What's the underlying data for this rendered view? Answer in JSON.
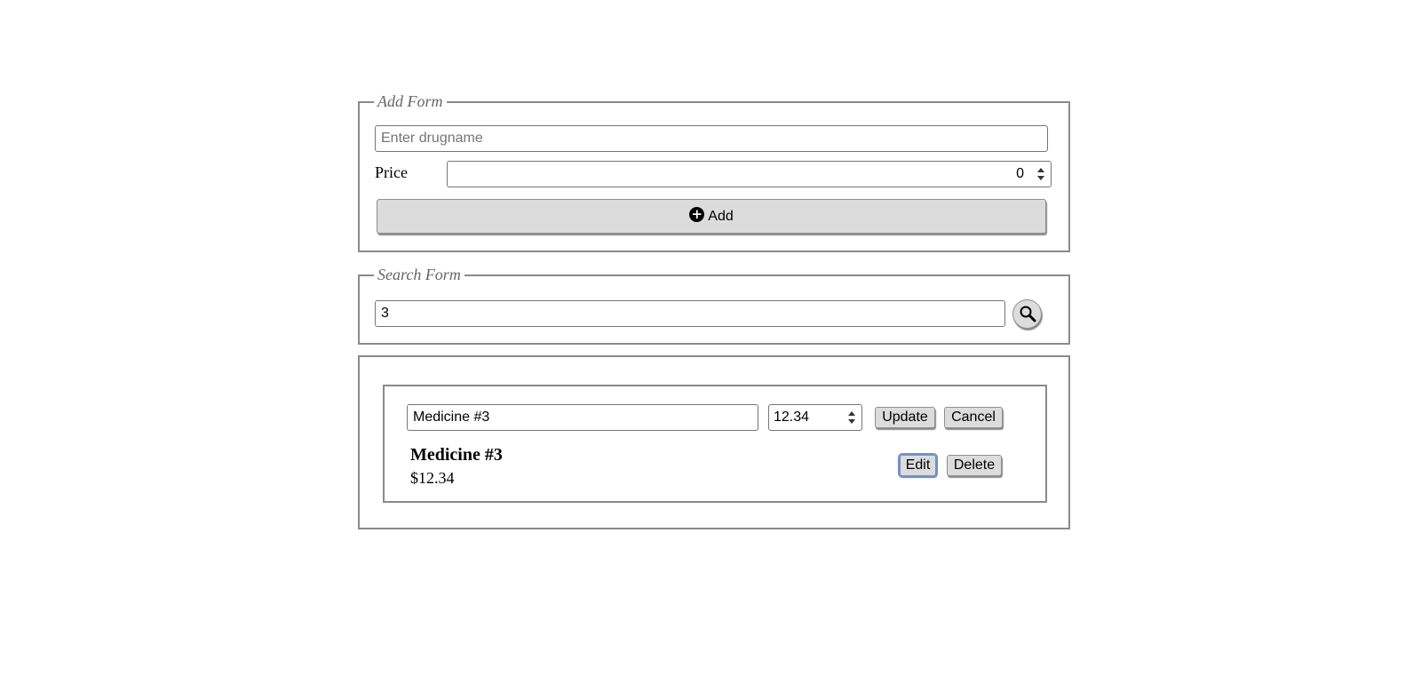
{
  "add_form": {
    "legend": "Add Form",
    "drugname_placeholder": "Enter drugname",
    "drugname_value": "",
    "price_label": "Price",
    "price_value": "0",
    "add_button_label": "Add"
  },
  "search_form": {
    "legend": "Search Form",
    "query_value": "3"
  },
  "results": {
    "item": {
      "edit_name_value": "Medicine #3",
      "edit_price_value": "12.34",
      "update_label": "Update",
      "cancel_label": "Cancel",
      "name": "Medicine #3",
      "price": "$12.34",
      "edit_label": "Edit",
      "delete_label": "Delete"
    }
  },
  "icons": {
    "add": "plus-circle-icon",
    "search": "magnifier-icon",
    "spinner": "spinner-arrows-icon"
  }
}
